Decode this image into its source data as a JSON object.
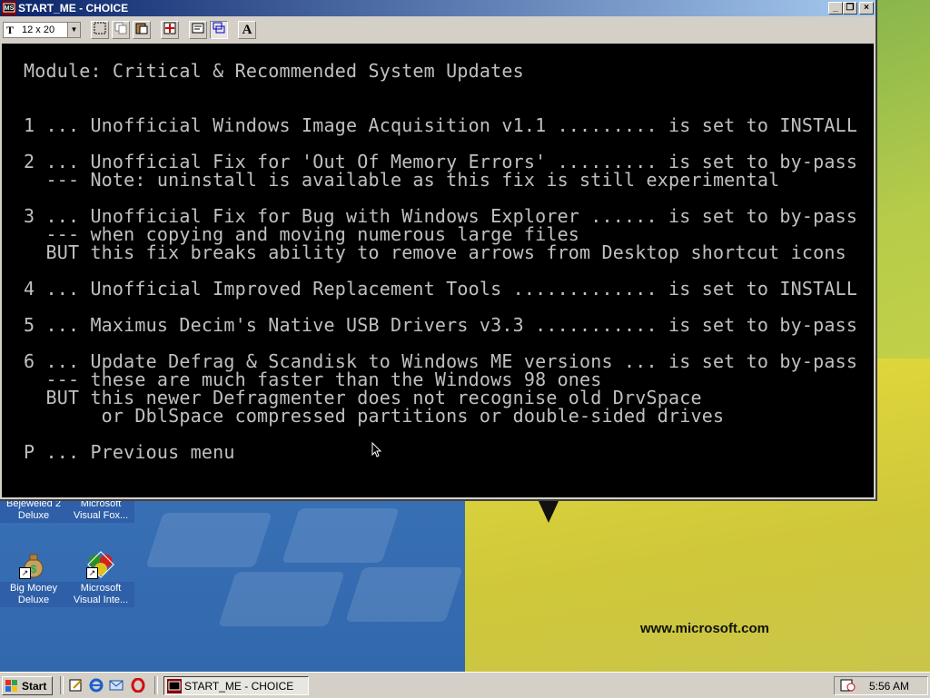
{
  "window": {
    "title": "START_ME - CHOICE",
    "toolbar": {
      "font_size": "12 x 20"
    }
  },
  "console": {
    "lines": [
      "Module: Critical & Recommended System Updates",
      "1 ... Unofficial Windows Image Acquisition v1.1 ......... is set to INSTALL",
      "2 ... Unofficial Fix for 'Out Of Memory Errors' ......... is set to by-pass",
      "  --- Note: uninstall is available as this fix is still experimental",
      "3 ... Unofficial Fix for Bug with Windows Explorer ...... is set to by-pass",
      "  --- when copying and moving numerous large files",
      "  BUT this fix breaks ability to remove arrows from Desktop shortcut icons",
      "4 ... Unofficial Improved Replacement Tools ............. is set to INSTALL",
      "5 ... Maximus Decim's Native USB Drivers v3.3 ........... is set to by-pass",
      "6 ... Update Defrag & Scandisk to Windows ME versions ... is set to by-pass",
      "  --- these are much faster than the Windows 98 ones",
      "  BUT this newer Defragmenter does not recognise old DrvSpace",
      "       or DblSpace compressed partitions or double-sided drives",
      "P ... Previous menu"
    ]
  },
  "desktop": {
    "icons": [
      {
        "label": "Bejeweled 2 Deluxe"
      },
      {
        "label": "Microsoft Visual Fox..."
      },
      {
        "label": "Big Money Deluxe"
      },
      {
        "label": "Microsoft Visual Inte..."
      }
    ],
    "brand": "www.microsoft.com"
  },
  "taskbar": {
    "start_label": "Start",
    "task_label": "START_ME - CHOICE",
    "clock": "5:56 AM"
  }
}
